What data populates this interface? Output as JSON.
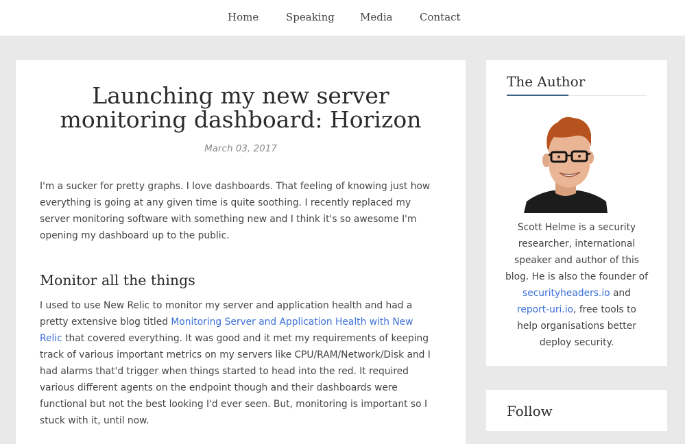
{
  "nav": {
    "items": [
      {
        "label": "Home"
      },
      {
        "label": "Speaking"
      },
      {
        "label": "Media"
      },
      {
        "label": "Contact"
      }
    ]
  },
  "post": {
    "title_line1": "Launching my new server",
    "title_line2": "monitoring dashboard: Horizon",
    "date": "March 03, 2017",
    "intro": "I'm a sucker for pretty graphs. I love dashboards. That feeling of knowing just how everything is going at any given time is quite soothing. I recently replaced my server monitoring software with something new and I think it's so awesome I'm opening my dashboard up to the public.",
    "section_heading": "Monitor all the things",
    "body_before_link": "I used to use New Relic to monitor my server and application health and had a pretty extensive blog titled ",
    "body_link": "Monitoring Server and Application Health with New Relic",
    "body_after_link": " that covered everything. It was good and it met my requirements of keeping track of various important metrics on my servers like CPU/RAM/Network/Disk and I had alarms that'd trigger when things started to head into the red. It required various different agents on the endpoint though and their dashboards were functional but not the best looking I'd ever seen. But, monitoring is important so I stuck with it, until now."
  },
  "sidebar": {
    "author_title": "The Author",
    "bio_before": "Scott Helme is a security researcher, international speaker and author of this blog. He is also the founder of ",
    "link1": "securityheaders.io",
    "bio_and": " and ",
    "link2": "report-uri.io",
    "bio_after": ", free tools to help organisations better deploy security.",
    "follow_title": "Follow"
  }
}
